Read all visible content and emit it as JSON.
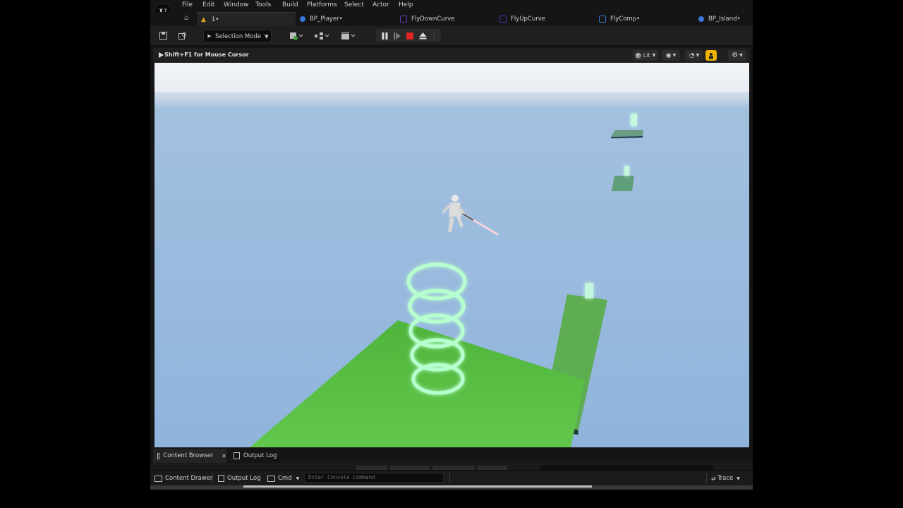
{
  "menu": {
    "items": [
      "File",
      "Edit",
      "Window",
      "Tools",
      "Build",
      "Platforms",
      "Select",
      "Actor",
      "Help"
    ]
  },
  "tabs": [
    {
      "label": "1•",
      "color": "#e0a020"
    },
    {
      "label": "BP_Player•",
      "color": "#3a78d8"
    },
    {
      "label": "FlyDownCurve",
      "color": "#5a3ab0"
    },
    {
      "label": "FlyUpCurve",
      "color": "#3a3ab0"
    },
    {
      "label": "FlyComp•",
      "color": "#3a78d8"
    },
    {
      "label": "BP_Island•",
      "color": "#3a78d8"
    }
  ],
  "toolbar": {
    "selection_mode": "Selection Mode"
  },
  "viewport": {
    "hint": "Shift+F1 for Mouse Cursor",
    "lit_label": "Lit"
  },
  "bottom_tabs": {
    "content_browser": "Content Browser",
    "output_log": "Output Log"
  },
  "statusbar": {
    "content_drawer": "Content Drawer",
    "output_log": "Output Log",
    "cmd": "Cmd",
    "console_placeholder": "Enter Console Command",
    "trace": "Trace"
  },
  "colors": {
    "accent_stop": "#e02424",
    "ground_green": "#5cbf45",
    "sky": "#8fb4dc",
    "spring_glow": "#b8ffd0"
  }
}
